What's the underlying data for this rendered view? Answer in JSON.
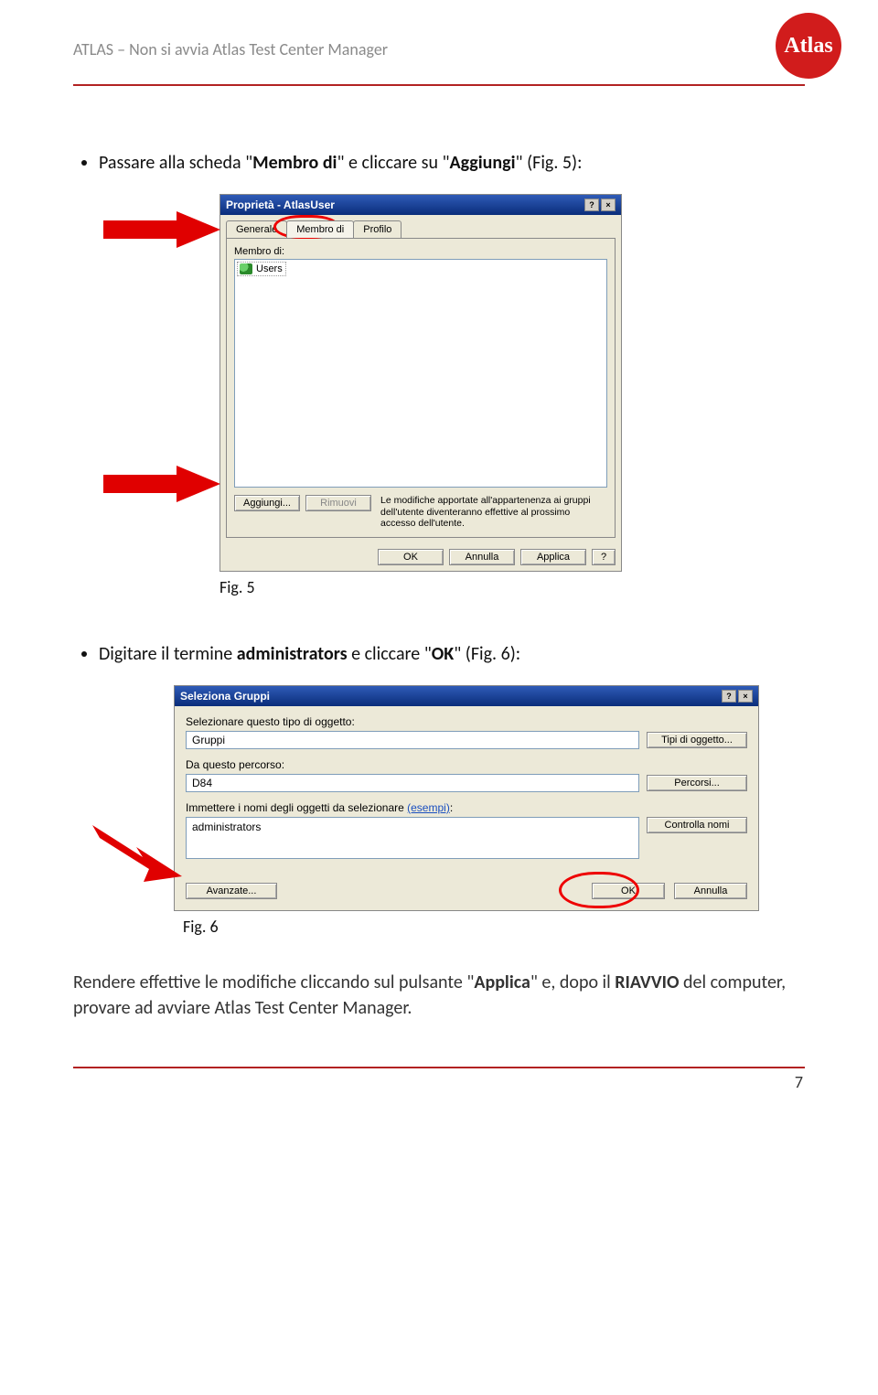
{
  "header": {
    "text": "ATLAS – Non si avvia Atlas Test Center Manager",
    "logo_text": "Atlas"
  },
  "bullet1": {
    "pre": "Passare alla scheda \"",
    "b1": "Membro di",
    "mid": "\" e cliccare su \"",
    "b2": "Aggiungi",
    "post": "\" (Fig. 5):"
  },
  "shot1": {
    "title": "Proprietà - AtlasUser",
    "tab_generale": "Generale",
    "tab_membro": "Membro di",
    "tab_profilo": "Profilo",
    "membro_di_label": "Membro di:",
    "users_item": "Users",
    "btn_aggiungi": "Aggiungi...",
    "btn_rimuovi": "Rimuovi",
    "note": "Le modifiche apportate all'appartenenza ai gruppi dell'utente diventeranno effettive al prossimo accesso dell'utente.",
    "ok": "OK",
    "annulla": "Annulla",
    "applica": "Applica",
    "help": "?"
  },
  "caption1": "Fig. 5",
  "bullet2": {
    "pre": "Digitare il termine ",
    "b1": "administrators",
    "mid": " e cliccare \"",
    "b2": "OK",
    "post": "\" (Fig. 6):"
  },
  "shot2": {
    "title": "Seleziona Gruppi",
    "lbl_tipo": "Selezionare questo tipo di oggetto:",
    "val_tipo": "Gruppi",
    "btn_tipi": "Tipi di oggetto...",
    "lbl_percorso": "Da questo percorso:",
    "val_percorso": "D84",
    "btn_percorsi": "Percorsi...",
    "lbl_nomi_pre": "Immettere i nomi degli oggetti da selezionare ",
    "lbl_nomi_link": "(esempi)",
    "lbl_nomi_post": ":",
    "val_nomi": "administrators",
    "btn_controlla": "Controlla nomi",
    "btn_avanzate": "Avanzate...",
    "ok": "OK",
    "annulla": "Annulla"
  },
  "caption2": "Fig. 6",
  "final": {
    "pre": "Rendere effettive le modifiche cliccando sul pulsante \"",
    "b1": "Applica",
    "mid": "\" e, dopo il ",
    "b2": "RIAVVIO",
    "post": " del computer, provare ad avviare Atlas Test Center Manager."
  },
  "pagenum": "7"
}
